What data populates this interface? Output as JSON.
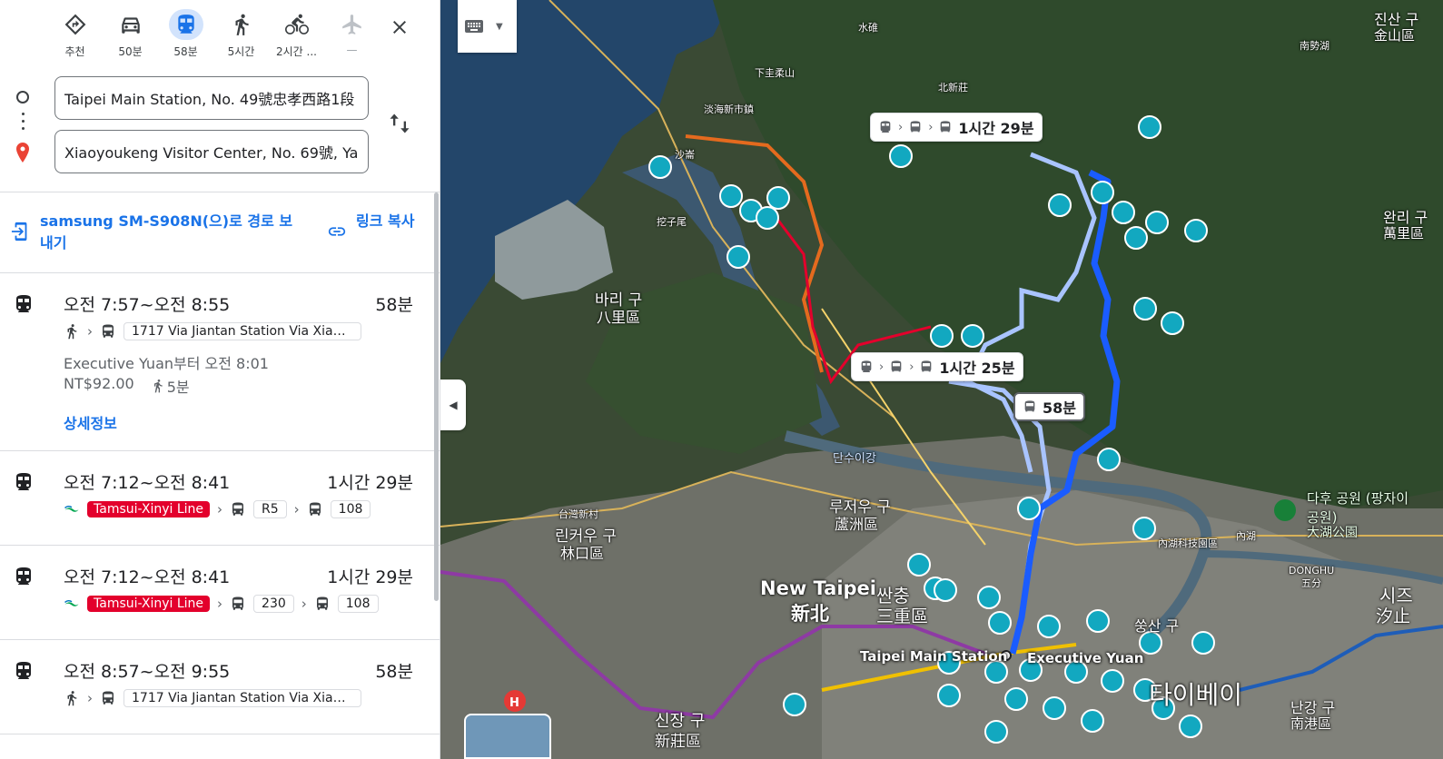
{
  "modes": [
    {
      "key": "recommended",
      "label": "추천",
      "icon": "directions-icon"
    },
    {
      "key": "drive",
      "label": "50분",
      "icon": "car-icon"
    },
    {
      "key": "transit",
      "label": "58분",
      "icon": "transit-icon",
      "selected": true
    },
    {
      "key": "walk",
      "label": "5시간",
      "icon": "walk-icon"
    },
    {
      "key": "bike",
      "label": "2시간 ...",
      "icon": "bike-icon"
    },
    {
      "key": "flight",
      "label": "—",
      "icon": "flight-icon"
    }
  ],
  "search": {
    "origin": "Taipei Main Station, No. 49號忠孝西路1段",
    "destination": "Xiaoyoukeng Visitor Center, No. 69號, Yar"
  },
  "actions": {
    "send_to_device": "samsung SM-S908N(으)로 경로 보내기",
    "copy_link": "링크 복사"
  },
  "routes": [
    {
      "time": "오전 7:57~오전 8:55",
      "duration": "58분",
      "bus": "1717 Via Jiantan Station Via Xiaoy...",
      "departure": "Executive Yuan부터 오전 8:01",
      "fare": "NT$92.00",
      "walk": "5분",
      "details": "상세정보"
    },
    {
      "time": "오전 7:12~오전 8:41",
      "duration": "1시간 29분",
      "line": "Tamsui-Xinyi Line",
      "bus1": "R5",
      "bus2": "108"
    },
    {
      "time": "오전 7:12~오전 8:41",
      "duration": "1시간 29분",
      "line": "Tamsui-Xinyi Line",
      "bus1": "230",
      "bus2": "108"
    },
    {
      "time": "오전 8:57~오전 9:55",
      "duration": "58분",
      "bus": "1717 Via Jiantan Station Via Xiaoy..."
    }
  ],
  "map": {
    "callouts": [
      {
        "duration": "1시간 29분"
      },
      {
        "duration": "1시간 25분"
      },
      {
        "duration": "58분"
      }
    ],
    "labels": {
      "new_taipei": "New Taipei",
      "new_taipei_zh": "新北",
      "sanchong": "싼충",
      "sanchong_zh": "三重區",
      "bali": "바리 구",
      "bali_zh": "八里區",
      "luzhou": "루저우 구",
      "luzhou_zh": "蘆洲區",
      "linkou": "린커우 구",
      "linkou_zh": "林口區",
      "taipei_main": "Taipei Main Station",
      "executive_yuan": "Executive Yuan",
      "taipei": "타이베이",
      "songshan": "쑹산 구",
      "nangang": "난강 구",
      "nangang_zh": "南港區",
      "xizhi": "시즈",
      "xizhi_zh": "汐止",
      "wanli": "완리 구",
      "wanli_zh": "萬里區",
      "jinshan": "진산 구",
      "jinshan_zh": "金山區",
      "dahu": "다후 공원 (팡자이 공원)",
      "dahu_zh": "大湖公園",
      "xinzhuang": "신장 구",
      "xinzhuang_zh": "新莊區",
      "tamsui_river": "단수이강",
      "shuidui": "水碓",
      "xiagui": "下圭柔山",
      "beixin": "北新莊",
      "tamsui_new": "淡海新市鎮",
      "shalun": "沙崙",
      "tingzi": "挖子尾",
      "taiwan_new": "台灣新村",
      "neihu_tech": "內湖科技園區",
      "neihu": "內湖",
      "donghu": "DONGHU",
      "wufen": "五分",
      "nanshi": "南勢湖"
    },
    "colors": {
      "route_primary": "#1a5cff",
      "route_alt": "#a9c4ff",
      "poi": "#12a8c0",
      "metro_red": "#e3002c"
    }
  }
}
